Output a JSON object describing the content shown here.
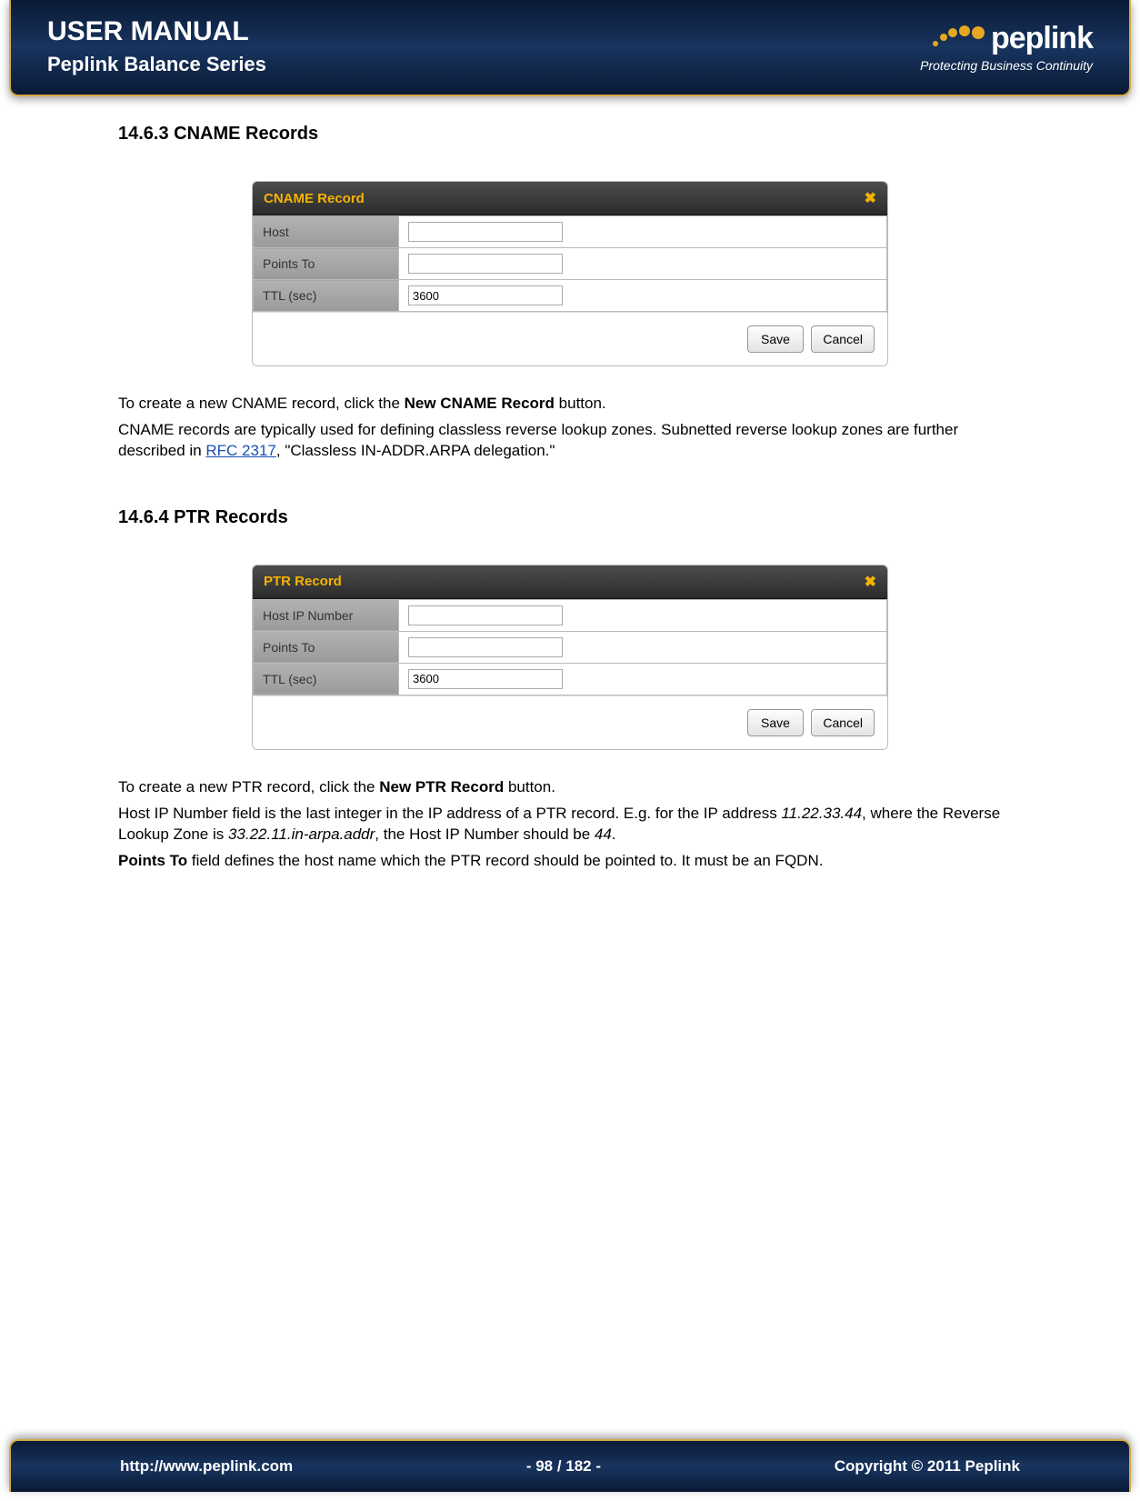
{
  "header": {
    "title": "USER MANUAL",
    "subtitle": "Peplink Balance Series",
    "brand": "peplink",
    "tagline": "Protecting Business Continuity"
  },
  "section_cname": {
    "heading": "14.6.3 CNAME Records",
    "panel_title": "CNAME Record",
    "rows": {
      "host_label": "Host",
      "host_value": "",
      "points_label": "Points To",
      "points_value": "",
      "ttl_label": "TTL (sec)",
      "ttl_value": "3600"
    },
    "save_label": "Save",
    "cancel_label": "Cancel",
    "para1_pre": "To create a new CNAME record, click the ",
    "para1_bold": "New CNAME Record",
    "para1_post": " button.",
    "para2_pre": "CNAME records are typically used for defining classless reverse lookup zones.  Subnetted reverse lookup zones are further described in ",
    "para2_link": "RFC 2317",
    "para2_post": ", \"Classless IN-ADDR.ARPA delegation.\""
  },
  "section_ptr": {
    "heading": "14.6.4 PTR Records",
    "panel_title": "PTR Record",
    "rows": {
      "hostip_label": "Host IP Number",
      "hostip_value": "",
      "points_label": "Points To",
      "points_value": "",
      "ttl_label": "TTL (sec)",
      "ttl_value": "3600"
    },
    "save_label": "Save",
    "cancel_label": "Cancel",
    "para1_pre": "To create a new PTR record, click the ",
    "para1_bold": "New PTR Record",
    "para1_post": " button.",
    "para2_pre": "Host IP Number field is the last integer in the IP address of a PTR record.  E.g. for the IP address ",
    "para2_it1": "11.22.33.44",
    "para2_mid1": ", where the Reverse Lookup Zone is ",
    "para2_it2": "33.22.11.in-arpa.addr",
    "para2_mid2": ", the Host IP Number should be ",
    "para2_it3": "44",
    "para2_post": ".",
    "para3_bold": "Points To",
    "para3_post": " field defines the host name which the PTR record should be pointed to.  It must be an FQDN."
  },
  "footer": {
    "url": "http://www.peplink.com",
    "page": "- 98 / 182 -",
    "copyright": "Copyright © 2011 Peplink"
  }
}
